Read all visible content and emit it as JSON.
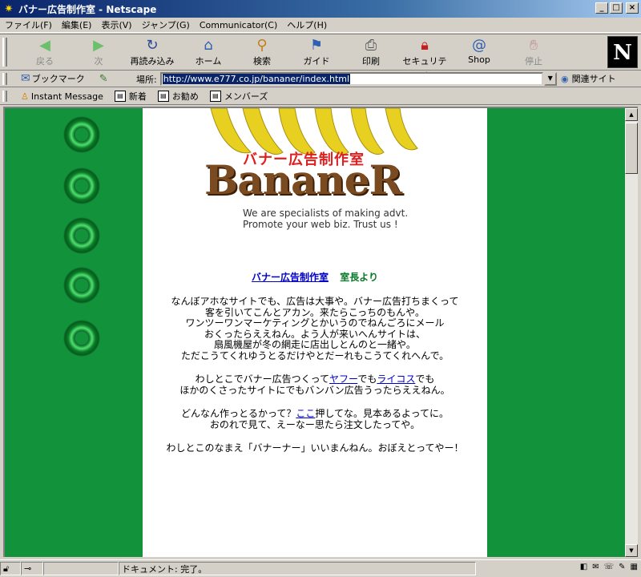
{
  "window": {
    "title": "バナー広告制作室 - Netscape",
    "controls": [
      "_",
      "□",
      "×"
    ]
  },
  "menu": [
    "ファイル(F)",
    "編集(E)",
    "表示(V)",
    "ジャンプ(G)",
    "Communicator(C)",
    "ヘルプ(H)"
  ],
  "toolbar": {
    "back": "戻る",
    "forward": "次",
    "reload": "再読み込み",
    "home": "ホーム",
    "search": "検索",
    "guide": "ガイド",
    "print": "印刷",
    "security": "セキュリティ",
    "shop": "Shop",
    "stop": "停止",
    "logo": "N"
  },
  "location": {
    "bookmarks_label": "ブックマーク",
    "location_label": "場所:",
    "url": "http://www.e777.co.jp/bananer/index.html",
    "related": "関連サイト"
  },
  "personal_bar": {
    "instant_message": "Instant Message",
    "new": "新着",
    "recommend": "お勧め",
    "members": "メンバーズ"
  },
  "page": {
    "banner_title": "バナー広告制作室",
    "banner_logo": "BananeR",
    "banner_sub1": "We are specialists of making advt.",
    "banner_sub2": "Promote your web biz. Trust us !",
    "heading_link": "バナー広告制作室",
    "heading_from": "室長より",
    "p1": [
      "なんぼアホなサイトでも、広告は大事や。バナー広告打ちまくって",
      "客を引いてこんとアカン。来たらこっちのもんや。",
      "ワンツーワンマーケティングとかいうのでねんごろにメール",
      "おくったらええねん。よう人が来いへんサイトは、",
      "扇風機屋が冬の網走に店出しとんのと一緒や。",
      "ただこうてくれゆうとるだけやとだーれもこうてくれへんで。"
    ],
    "p2_a": "わしとこでバナー広告つくって",
    "p2_link1": "ヤフー",
    "p2_b": "でも",
    "p2_link2": "ライコス",
    "p2_c": "でも",
    "p2_line2": "ほかのくさったサイトにでもバンバン広告うったらええねん。",
    "p3_a": "どんなん作っとるかって？",
    "p3_link": "ここ",
    "p3_b": "押してな。見本あるよってに。",
    "p3_line2": "おのれで見て、えーなー思たら注文したってや。",
    "p4": "わしとこのなまえ「バナーナー」いいまんねん。おぼえとってやー！"
  },
  "status": {
    "text": "ドキュメント: 完了。"
  },
  "colors": {
    "page_green": "#12923b",
    "link": "#0000cc",
    "title_bar": "#0a246a"
  }
}
